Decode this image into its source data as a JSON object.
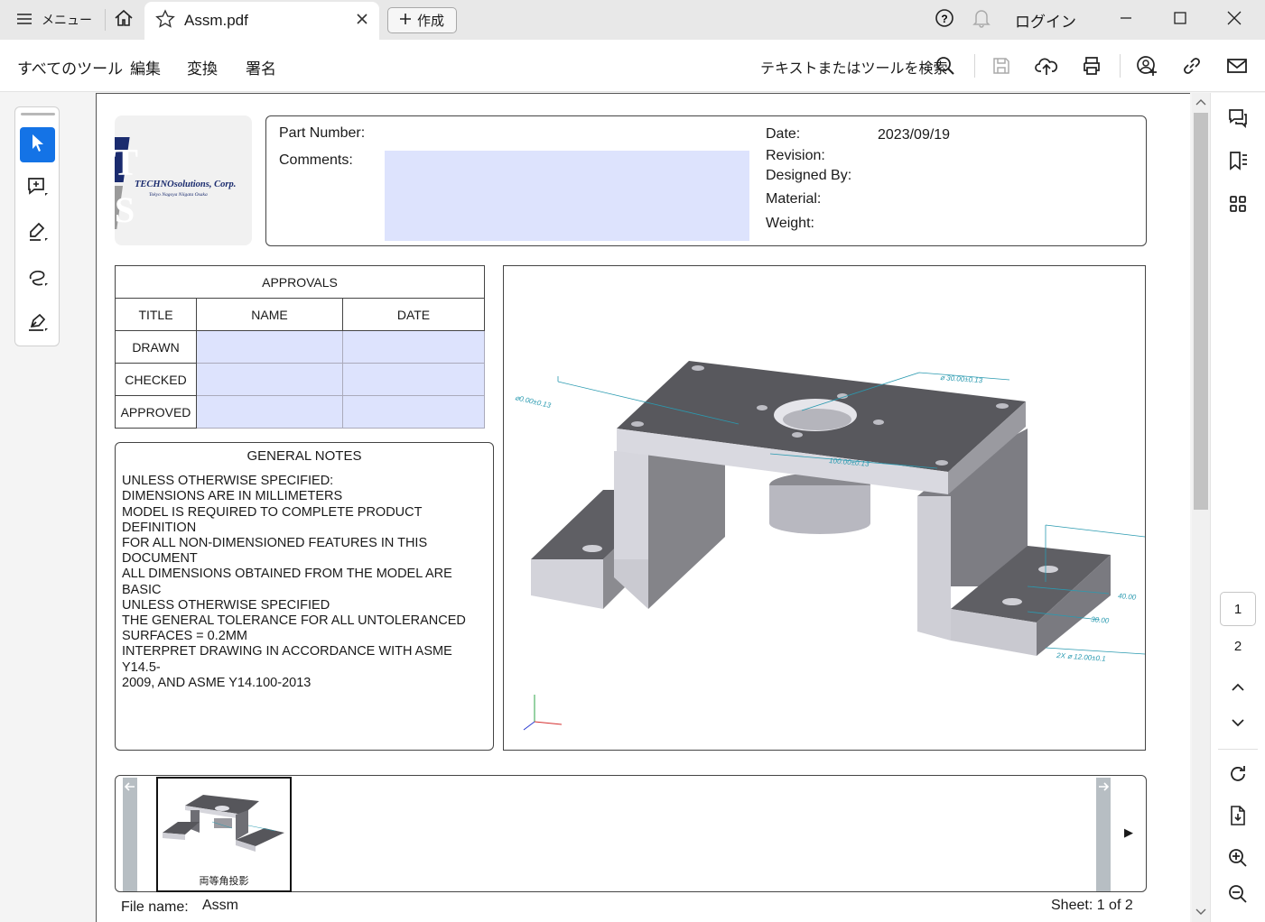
{
  "titlebar": {
    "menu_label": "メニュー",
    "tab_title": "Assm.pdf",
    "create_label": "作成",
    "login_label": "ログイン"
  },
  "toolbar": {
    "items": [
      "すべてのツール",
      "編集",
      "変換",
      "署名"
    ],
    "search_label": "テキストまたはツールを検索"
  },
  "sheet": {
    "info": {
      "part_number_label": "Part Number:",
      "comments_label": "Comments:",
      "date_label": "Date:",
      "date_value": "2023/09/19",
      "revision_label": "Revision:",
      "designed_by_label": "Designed By:",
      "material_label": "Material:",
      "weight_label": "Weight:"
    },
    "logo": {
      "company": "TECHNOsolutions, Corp.",
      "cities": "Tokyo  Nagoya  Niigata  Osaka",
      "letters": [
        "T",
        "S"
      ]
    },
    "approvals": {
      "title": "APPROVALS",
      "columns": [
        "TITLE",
        "NAME",
        "DATE"
      ],
      "rows": [
        "DRAWN",
        "CHECKED",
        "APPROVED"
      ]
    },
    "notes": {
      "title": "GENERAL NOTES",
      "body": "UNLESS OTHERWISE SPECIFIED:\nDIMENSIONS ARE IN MILLIMETERS\nMODEL IS REQUIRED TO COMPLETE PRODUCT\nDEFINITION\nFOR ALL NON-DIMENSIONED FEATURES IN THIS\nDOCUMENT\nALL DIMENSIONS OBTAINED FROM THE MODEL ARE\nBASIC\nUNLESS OTHERWISE SPECIFIED\nTHE GENERAL TOLERANCE FOR ALL UNTOLERANCED\nSURFACES = 0.2MM\nINTERPRET DRAWING IN ACCORDANCE WITH ASME\nY14.5-\n2009, AND ASME Y14.100-2013"
    },
    "dimensions": [
      "⌀ 30.00±0.13",
      "⌀0.00±0.13",
      "100.00±0.13",
      "40.00",
      "30.00",
      "2X ⌀ 12.00±0.1"
    ],
    "thumbnail_caption": "両等角投影",
    "file_name_label": "File name:",
    "file_name_value": "Assm",
    "sheet_label": "Sheet: 1 of 2"
  },
  "pager": {
    "current": "1",
    "next": "2"
  },
  "colors": {
    "accent": "#1473e6",
    "form_field": "#dde3fd",
    "dimension": "#2a9ab0"
  }
}
